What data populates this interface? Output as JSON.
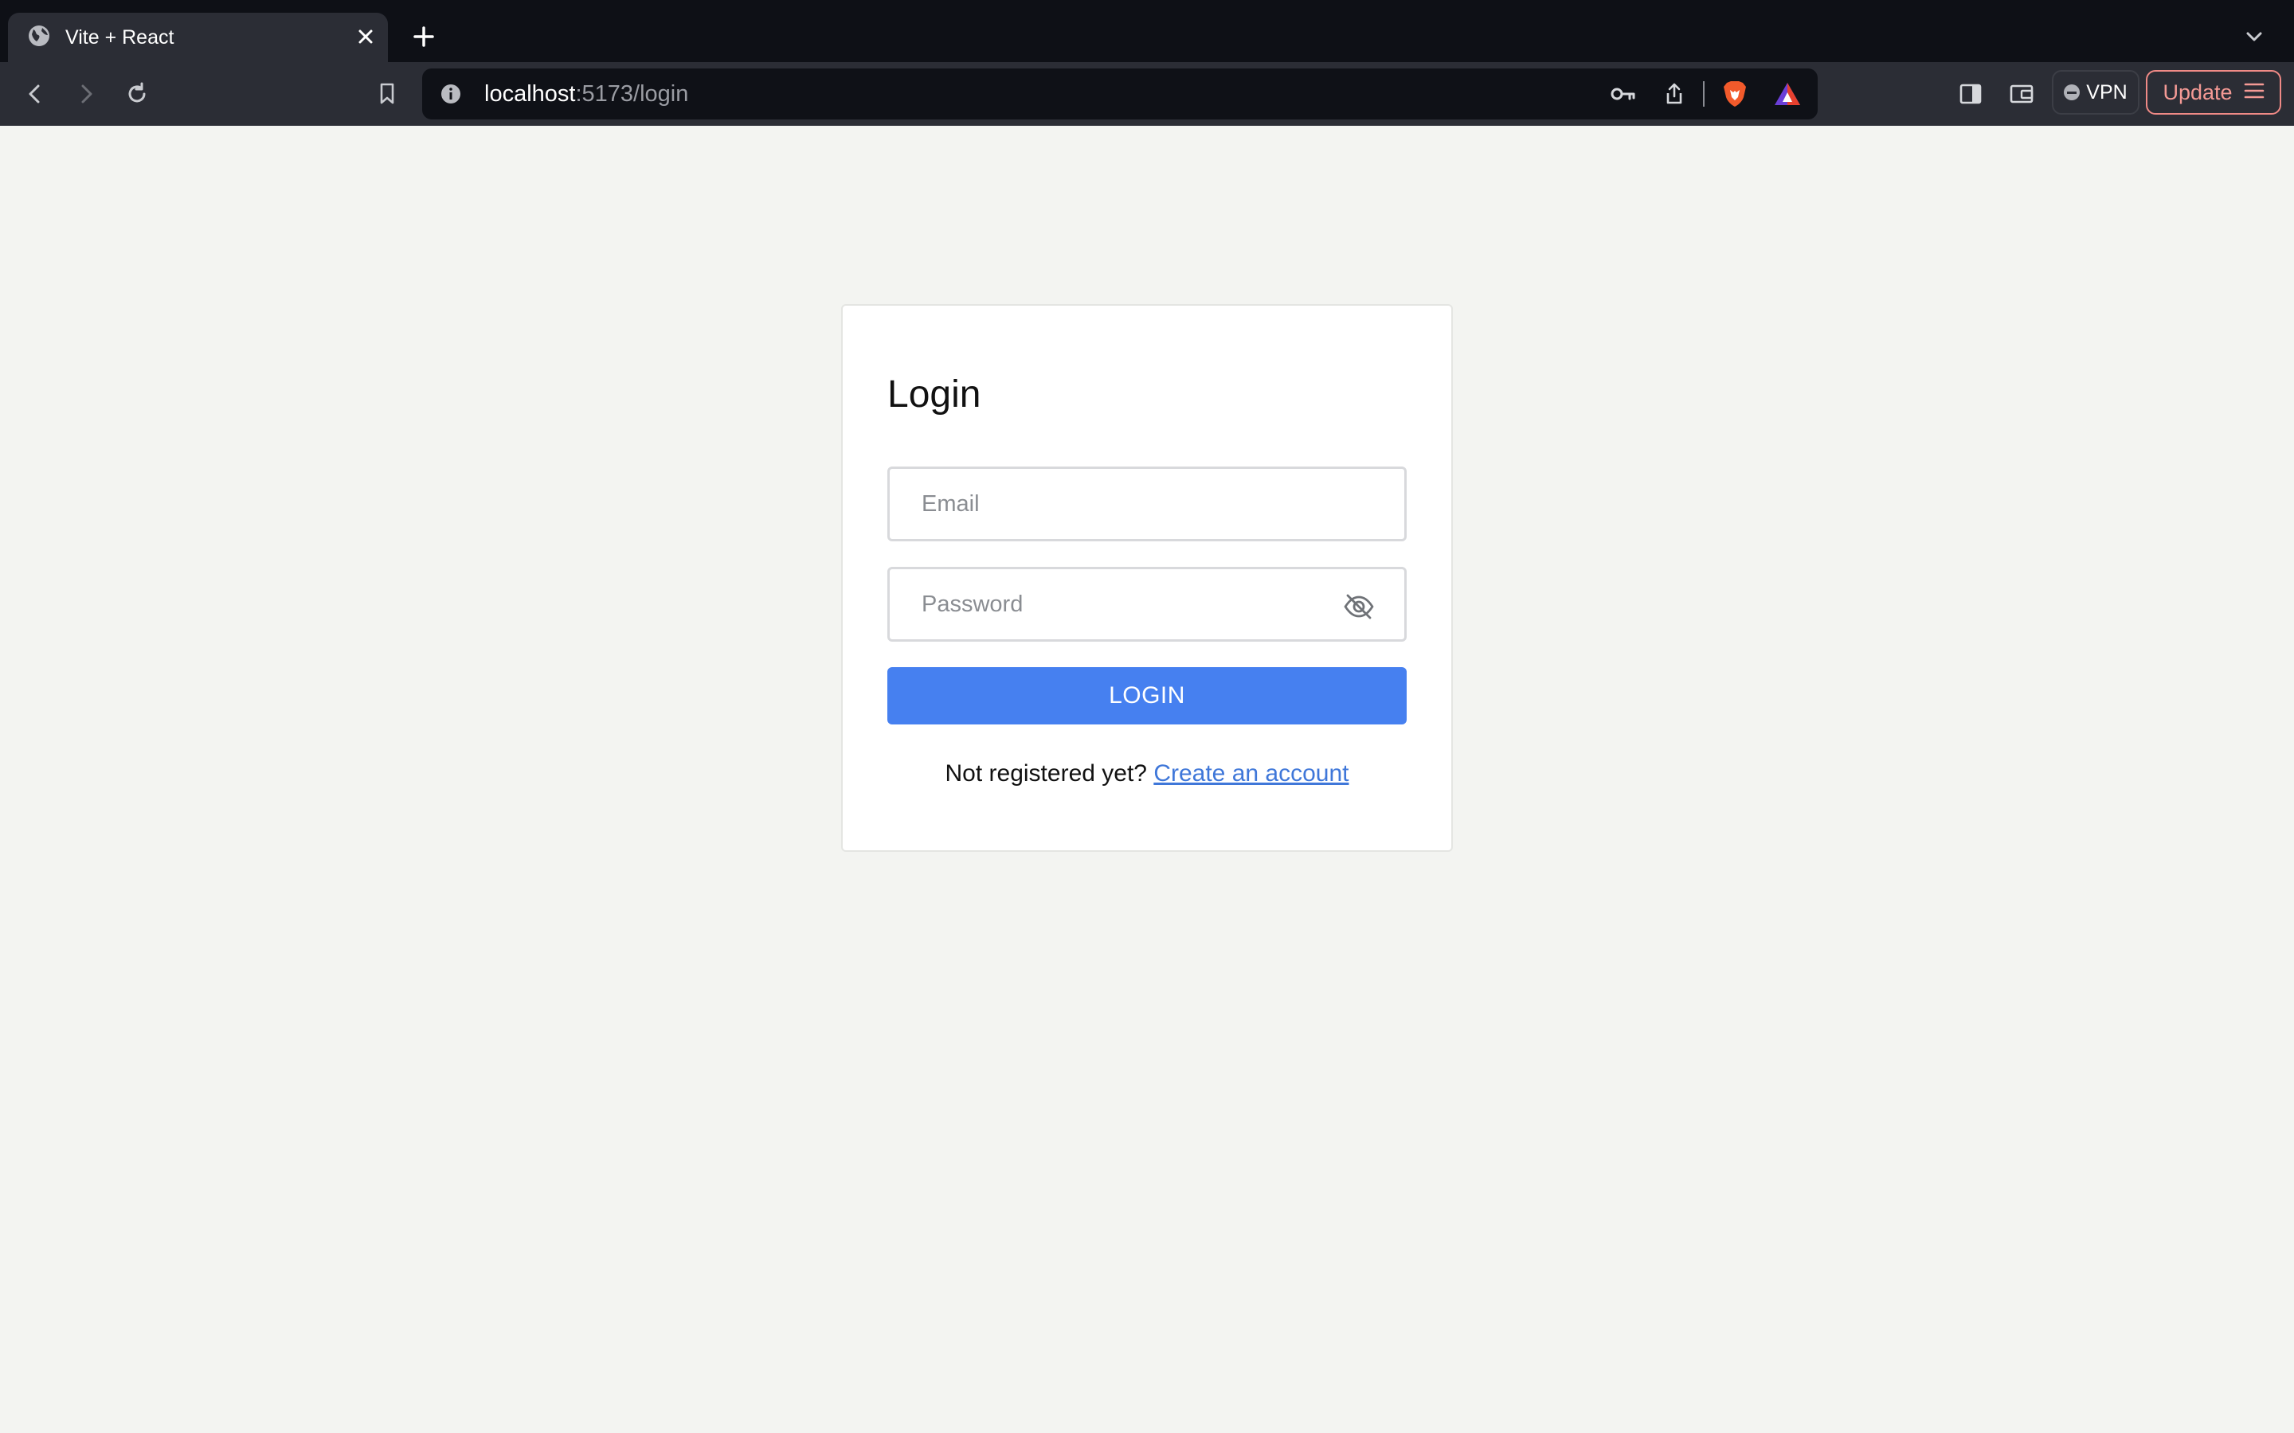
{
  "browser": {
    "tab": {
      "title": "Vite + React",
      "favicon": "globe-icon",
      "close": "close-icon"
    },
    "new_tab": "plus-icon",
    "tab_list": "chevron-down-icon",
    "toolbar": {
      "back": "back-arrow-icon",
      "forward": "forward-arrow-icon",
      "reload": "reload-icon",
      "bookmark": "bookmark-icon",
      "url_host": "localhost",
      "url_path": ":5173/login",
      "site_info": "info-icon",
      "password_key": "key-icon",
      "share": "share-icon",
      "brave_shields": "brave-lion-icon",
      "brave_rewards": "rewards-triangle-icon",
      "sidebar": "sidebar-icon",
      "wallet": "wallet-icon",
      "vpn_label": "VPN",
      "update_label": "Update",
      "menu": "hamburger-menu-icon"
    }
  },
  "login": {
    "title": "Login",
    "email_placeholder": "Email",
    "password_placeholder": "Password",
    "visibility_toggle": "eye-off-icon",
    "submit_label": "LOGIN",
    "register_prompt": "Not registered yet? ",
    "register_link": "Create an account"
  },
  "colors": {
    "page_background": "#f3f4f1",
    "primary_button": "#4680f0",
    "link": "#3f77d9",
    "update_accent": "#f08a86"
  }
}
